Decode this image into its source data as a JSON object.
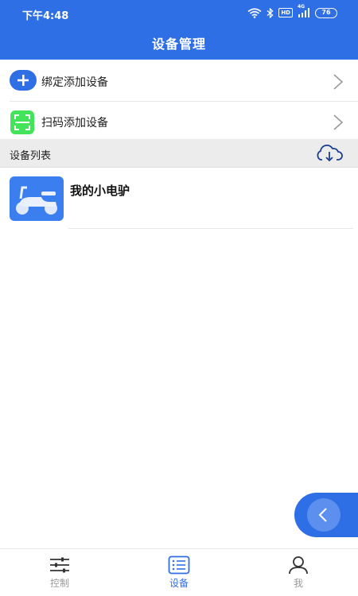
{
  "status_bar": {
    "time": "下午4:48",
    "network": "4G",
    "hd": "HD",
    "battery": "76"
  },
  "header": {
    "title": "设备管理"
  },
  "actions": [
    {
      "label": "绑定添加设备",
      "icon": "plus-circle-icon"
    },
    {
      "label": "扫码添加设备",
      "icon": "scan-icon"
    }
  ],
  "section": {
    "title": "设备列表",
    "icon": "cloud-download-icon"
  },
  "devices": [
    {
      "name": "我的小电驴",
      "icon": "scooter-icon"
    }
  ],
  "tabbar": {
    "items": [
      {
        "label": "控制",
        "icon": "sliders-icon",
        "active": false
      },
      {
        "label": "设备",
        "icon": "list-icon",
        "active": true
      },
      {
        "label": "我",
        "icon": "user-icon",
        "active": false
      }
    ]
  },
  "colors": {
    "primary": "#2f6fe6",
    "scan_green": "#43e35a",
    "section_bg": "#ececec",
    "inactive_tab": "#999999"
  }
}
